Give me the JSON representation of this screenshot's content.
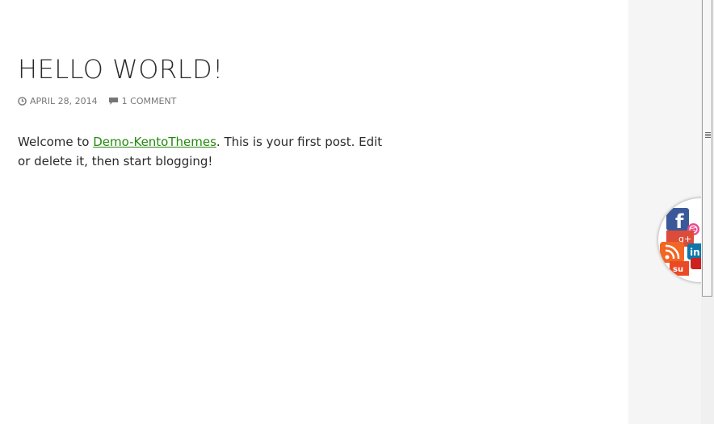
{
  "post": {
    "title": "HELLO WORLD!",
    "date": "APRIL 28, 2014",
    "comments": "1 COMMENT",
    "intro": "Welcome to ",
    "link_text": "Demo-KentoThemes",
    "rest": ". This is your first post. Edit or delete it, then start blogging!"
  },
  "social": {
    "icons": [
      "facebook-icon",
      "dribbble-icon",
      "google-plus-icon",
      "rss-icon",
      "linkedin-icon",
      "stumbleupon-icon"
    ],
    "labels": {
      "facebook": "f",
      "google_plus": "g+",
      "linkedin": "in",
      "stumbleupon": "su"
    }
  },
  "colors": {
    "link": "#24890d",
    "meta": "#767676",
    "text": "#2b2b2b",
    "sidebar": "#f5f5f5"
  }
}
